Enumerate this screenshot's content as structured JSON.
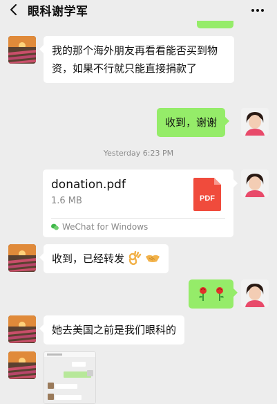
{
  "header": {
    "title": "眼科谢学军",
    "back_icon": "chevron-left-icon",
    "more_icon": "more-dots-icon"
  },
  "messages": [
    {
      "side": "left",
      "text": "我的那个海外朋友再看看能否买到物资，如果不行就只能直接捐款了"
    },
    {
      "side": "right",
      "text": "收到，谢谢"
    },
    {
      "side": "right",
      "type": "file",
      "file_name": "donation.pdf",
      "file_size": "1.6 MB",
      "file_type": "PDF",
      "source": "WeChat for Windows"
    },
    {
      "side": "left",
      "text": "收到，已经转发",
      "emoji": [
        "ok-hand-emoji",
        "handshake-emoji"
      ]
    },
    {
      "side": "right",
      "emoji": [
        "rose-emoji",
        "rose-emoji"
      ]
    },
    {
      "side": "left",
      "text": "她去美国之前是我们眼科的"
    },
    {
      "side": "left",
      "type": "image-thumbnail"
    }
  ],
  "timestamp": "Yesterday 6:23 PM",
  "colors": {
    "background": "#ededed",
    "green_bubble": "#95ec69",
    "white_bubble": "#ffffff",
    "pdf_red": "#f04b3c"
  }
}
